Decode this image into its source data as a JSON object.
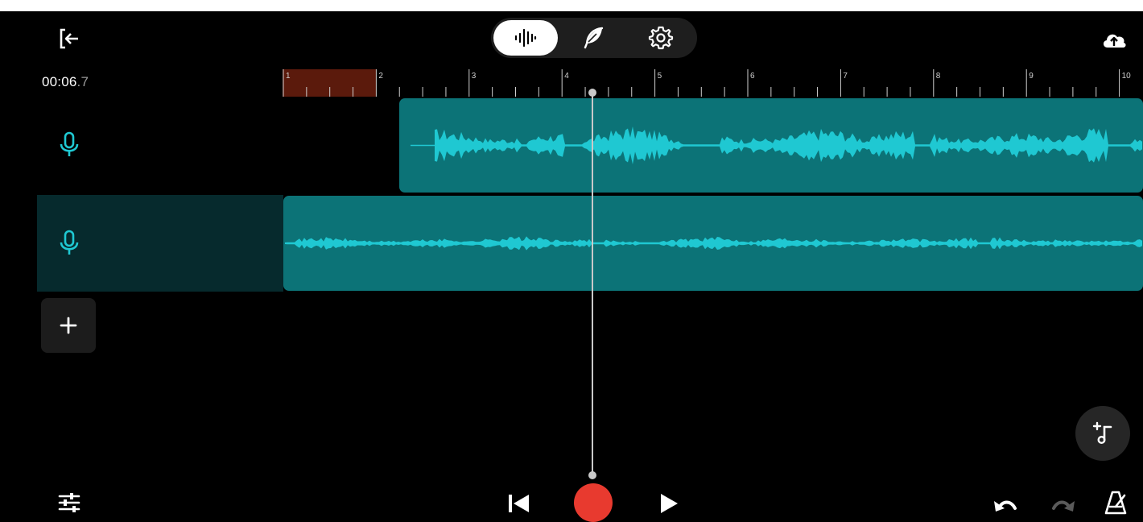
{
  "header": {
    "exit_icon": "exit-icon",
    "upload_icon": "cloud-upload-icon",
    "tabs": [
      {
        "name": "waveform",
        "icon": "waveform-icon",
        "active": true
      },
      {
        "name": "effects",
        "icon": "feather-icon",
        "active": false
      },
      {
        "name": "settings",
        "icon": "gear-icon",
        "active": false
      }
    ]
  },
  "time": {
    "main": "00:06",
    "fraction": ".7"
  },
  "ruler": {
    "bars": [
      "1",
      "2",
      "3",
      "4",
      "5",
      "6",
      "7",
      "8",
      "9",
      "10"
    ]
  },
  "tracks": [
    {
      "icon": "microphone-icon",
      "selected": false
    },
    {
      "icon": "microphone-icon",
      "selected": true
    }
  ],
  "add_track_icon": "plus-icon",
  "add_instrument_icon": "add-music-note-icon",
  "transport": {
    "mixer_icon": "sliders-icon",
    "rewind_icon": "skip-to-start-icon",
    "record_icon": "record-icon",
    "play_icon": "play-icon",
    "undo_icon": "undo-icon",
    "redo_icon": "redo-icon",
    "metronome_icon": "metronome-icon"
  },
  "colors": {
    "background": "#000000",
    "clip": "#0c7377",
    "waveform": "#1fc8d2",
    "selected_track_header": "#062a2d",
    "loop_region": "#5b1a0c",
    "record": "#e83a2f"
  }
}
